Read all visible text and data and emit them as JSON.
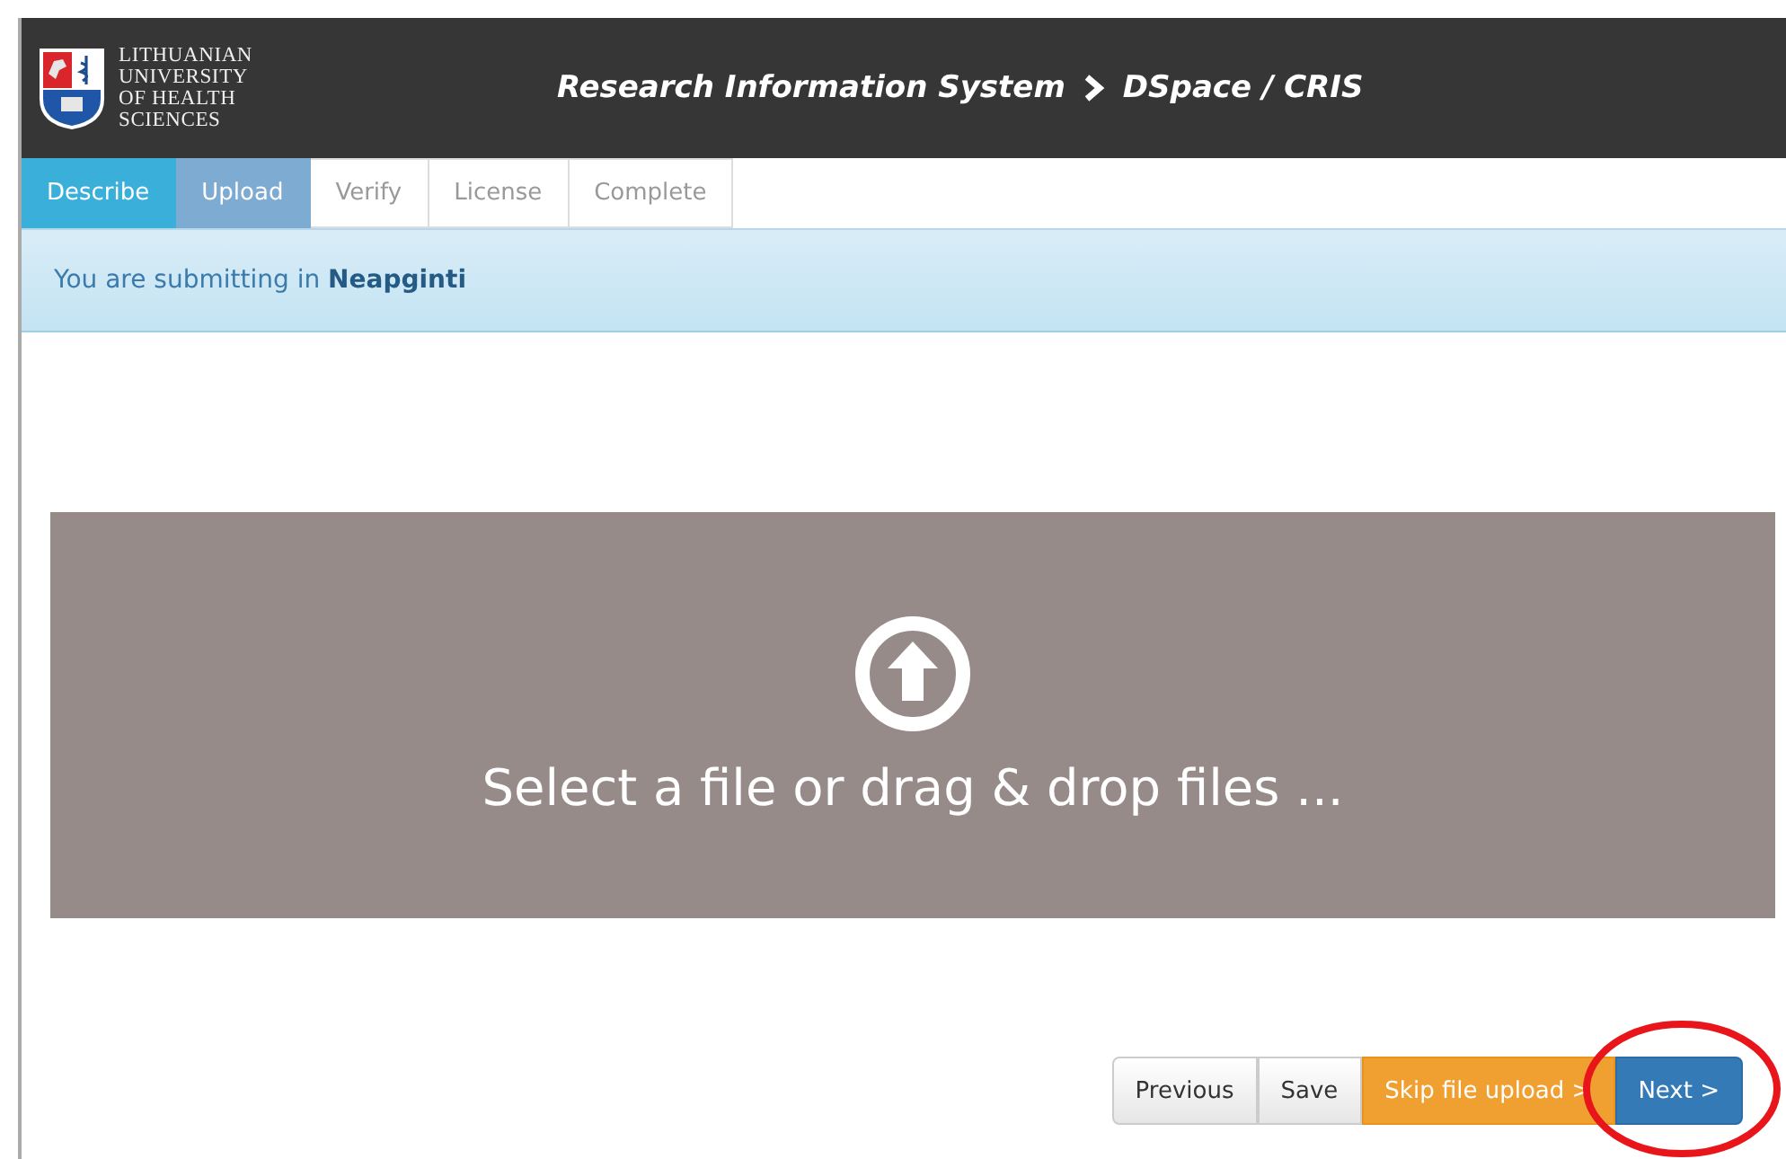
{
  "header": {
    "logo_lines": [
      "LITHUANIAN",
      "UNIVERSITY",
      "OF HEALTH",
      "SCIENCES"
    ],
    "title": "Research Information System",
    "subtitle": "DSpace / CRIS"
  },
  "tabs": [
    {
      "label": "Describe",
      "selected": false,
      "completed": true
    },
    {
      "label": "Upload",
      "selected": true,
      "completed": false
    },
    {
      "label": "Verify",
      "selected": false,
      "completed": false
    },
    {
      "label": "License",
      "selected": false,
      "completed": false
    },
    {
      "label": "Complete",
      "selected": false,
      "completed": false
    }
  ],
  "notice": {
    "text": "You are submitting in **Neapginti**"
  },
  "dropzone": {
    "text": "Select a file or drag & drop files ..."
  },
  "buttons": [
    {
      "label": "Previous",
      "kind": "default"
    },
    {
      "label": "Save",
      "kind": "default"
    },
    {
      "label": "Skip file upload >",
      "kind": "warning"
    },
    {
      "label": "Next >",
      "kind": "primary"
    }
  ],
  "annotation": {
    "kind": "ellipse",
    "color": "#e8151b"
  }
}
